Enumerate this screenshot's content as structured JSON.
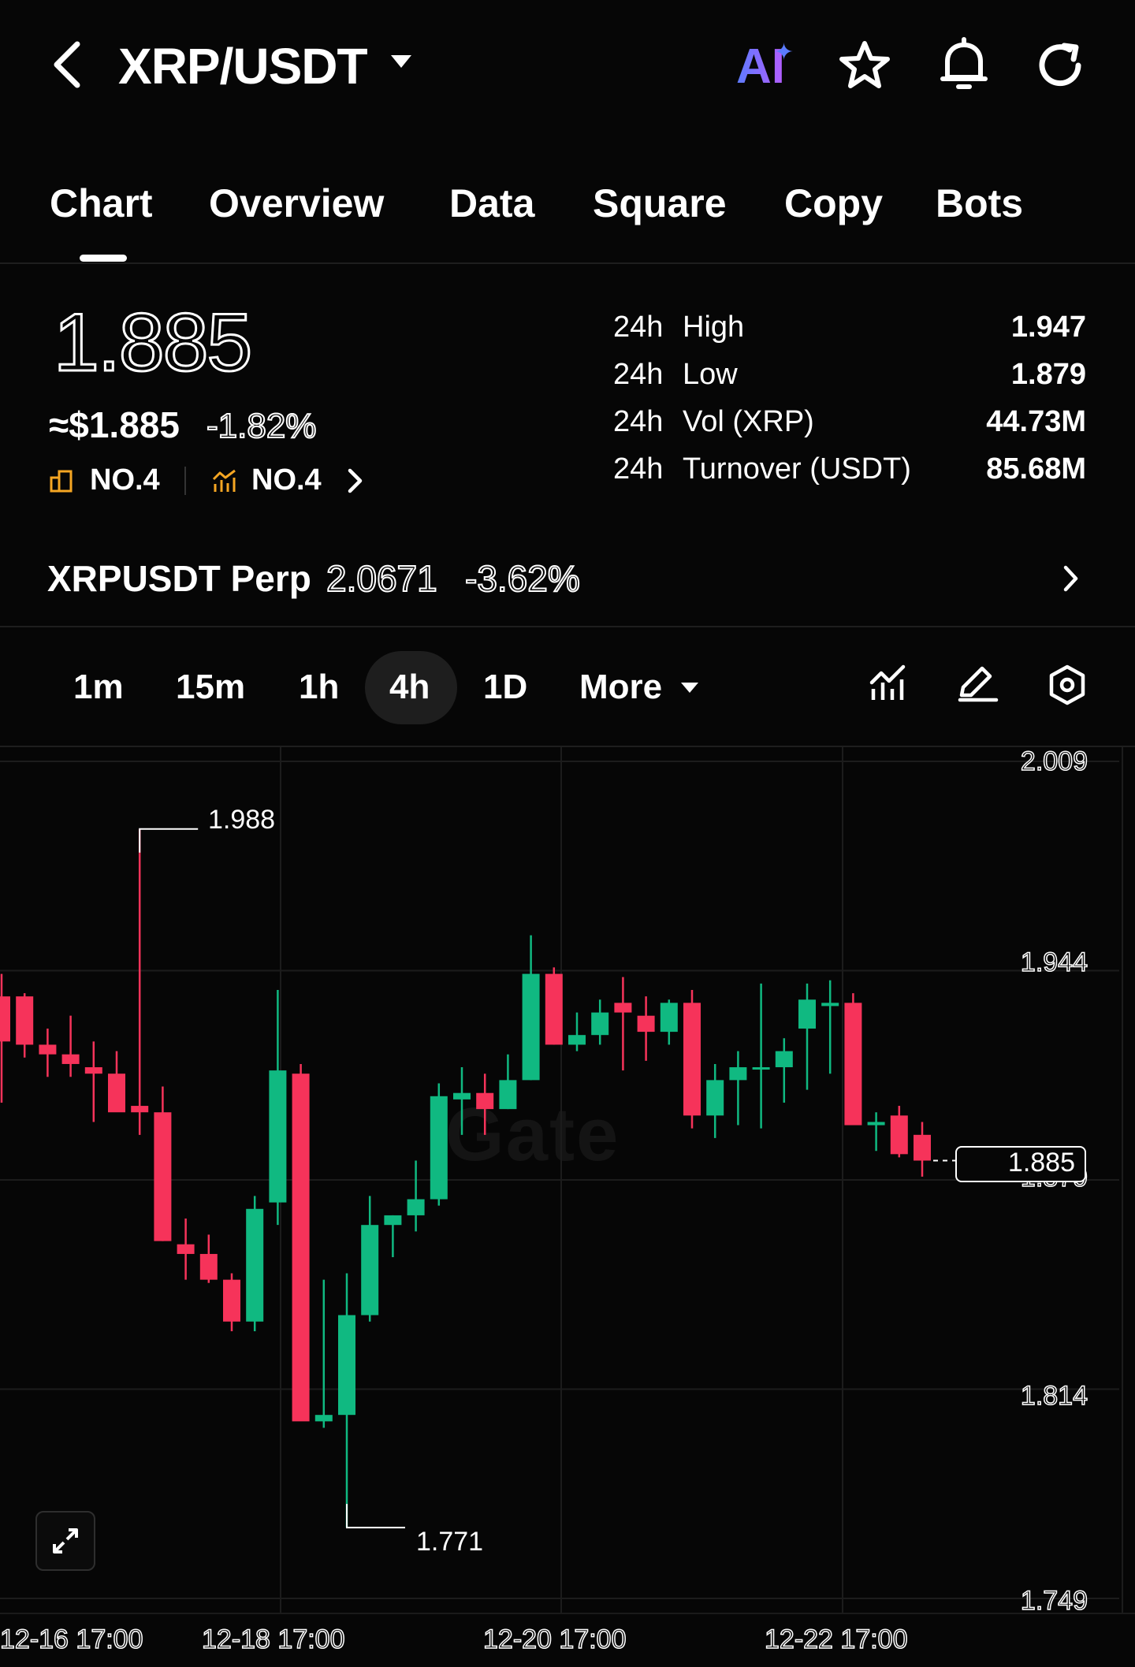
{
  "header": {
    "pair": "XRP/USDT",
    "ai_label": "AI"
  },
  "tabs": [
    {
      "label": "Chart",
      "active": true
    },
    {
      "label": "Overview"
    },
    {
      "label": "Data"
    },
    {
      "label": "Square"
    },
    {
      "label": "Copy"
    },
    {
      "label": "Bots"
    }
  ],
  "price": {
    "last": "1.885",
    "usd": "≈$1.885",
    "change": "-1.82%",
    "rank1": "NO.4",
    "rank2": "NO.4"
  },
  "stats": [
    {
      "period": "24h",
      "label": "High",
      "value": "1.947"
    },
    {
      "period": "24h",
      "label": "Low",
      "value": "1.879"
    },
    {
      "period": "24h",
      "label": "Vol (XRP)",
      "value": "44.73M"
    },
    {
      "period": "24h",
      "label": "Turnover (USDT)",
      "value": "85.68M"
    }
  ],
  "perp": {
    "name": "XRPUSDT Perp",
    "price": "2.0671",
    "change": "-3.62%"
  },
  "intervals": [
    "1m",
    "15m",
    "1h",
    "4h",
    "1D",
    "More"
  ],
  "active_interval": "4h",
  "colors": {
    "up": "#10b981",
    "down": "#f6335a",
    "background": "#060606"
  },
  "chart_data": {
    "type": "candlestick",
    "watermark": "Gate",
    "y_ticks": [
      "2.009",
      "1.944",
      "1.879",
      "1.814",
      "1.749"
    ],
    "ylim": [
      1.749,
      2.009
    ],
    "x_ticks": [
      "12-16 17:00",
      "12-18 17:00",
      "12-20 17:00",
      "12-22 17:00"
    ],
    "high_label": "1.988",
    "low_label": "1.771",
    "last_price_label": "1.885",
    "candles": [
      {
        "o": 1.936,
        "h": 1.943,
        "l": 1.903,
        "c": 1.922
      },
      {
        "o": 1.936,
        "h": 1.937,
        "l": 1.917,
        "c": 1.921
      },
      {
        "o": 1.921,
        "h": 1.926,
        "l": 1.911,
        "c": 1.918
      },
      {
        "o": 1.918,
        "h": 1.93,
        "l": 1.911,
        "c": 1.915
      },
      {
        "o": 1.914,
        "h": 1.922,
        "l": 1.897,
        "c": 1.912
      },
      {
        "o": 1.912,
        "h": 1.919,
        "l": 1.901,
        "c": 1.9
      },
      {
        "o": 1.902,
        "h": 1.988,
        "l": 1.893,
        "c": 1.9
      },
      {
        "o": 1.9,
        "h": 1.908,
        "l": 1.86,
        "c": 1.86
      },
      {
        "o": 1.859,
        "h": 1.867,
        "l": 1.848,
        "c": 1.856
      },
      {
        "o": 1.856,
        "h": 1.862,
        "l": 1.847,
        "c": 1.848
      },
      {
        "o": 1.848,
        "h": 1.85,
        "l": 1.832,
        "c": 1.835
      },
      {
        "o": 1.835,
        "h": 1.874,
        "l": 1.832,
        "c": 1.87
      },
      {
        "o": 1.872,
        "h": 1.938,
        "l": 1.865,
        "c": 1.913
      },
      {
        "o": 1.912,
        "h": 1.915,
        "l": 1.805,
        "c": 1.804
      },
      {
        "o": 1.804,
        "h": 1.848,
        "l": 1.802,
        "c": 1.806
      },
      {
        "o": 1.806,
        "h": 1.85,
        "l": 1.771,
        "c": 1.837
      },
      {
        "o": 1.837,
        "h": 1.874,
        "l": 1.835,
        "c": 1.865
      },
      {
        "o": 1.865,
        "h": 1.868,
        "l": 1.855,
        "c": 1.868
      },
      {
        "o": 1.868,
        "h": 1.885,
        "l": 1.863,
        "c": 1.873
      },
      {
        "o": 1.873,
        "h": 1.909,
        "l": 1.871,
        "c": 1.905
      },
      {
        "o": 1.904,
        "h": 1.914,
        "l": 1.893,
        "c": 1.906
      },
      {
        "o": 1.906,
        "h": 1.912,
        "l": 1.893,
        "c": 1.901
      },
      {
        "o": 1.901,
        "h": 1.918,
        "l": 1.901,
        "c": 1.91
      },
      {
        "o": 1.91,
        "h": 1.955,
        "l": 1.91,
        "c": 1.943
      },
      {
        "o": 1.943,
        "h": 1.945,
        "l": 1.921,
        "c": 1.921
      },
      {
        "o": 1.921,
        "h": 1.931,
        "l": 1.919,
        "c": 1.924
      },
      {
        "o": 1.924,
        "h": 1.935,
        "l": 1.921,
        "c": 1.931
      },
      {
        "o": 1.934,
        "h": 1.942,
        "l": 1.913,
        "c": 1.931
      },
      {
        "o": 1.93,
        "h": 1.936,
        "l": 1.916,
        "c": 1.925
      },
      {
        "o": 1.925,
        "h": 1.935,
        "l": 1.921,
        "c": 1.934
      },
      {
        "o": 1.934,
        "h": 1.938,
        "l": 1.895,
        "c": 1.899
      },
      {
        "o": 1.899,
        "h": 1.915,
        "l": 1.892,
        "c": 1.91
      },
      {
        "o": 1.91,
        "h": 1.919,
        "l": 1.896,
        "c": 1.914
      },
      {
        "o": 1.914,
        "h": 1.94,
        "l": 1.895,
        "c": 1.914
      },
      {
        "o": 1.914,
        "h": 1.923,
        "l": 1.903,
        "c": 1.919
      },
      {
        "o": 1.926,
        "h": 1.94,
        "l": 1.907,
        "c": 1.935
      },
      {
        "o": 1.933,
        "h": 1.941,
        "l": 1.912,
        "c": 1.934
      },
      {
        "o": 1.934,
        "h": 1.937,
        "l": 1.896,
        "c": 1.896
      },
      {
        "o": 1.896,
        "h": 1.9,
        "l": 1.888,
        "c": 1.897
      },
      {
        "o": 1.899,
        "h": 1.902,
        "l": 1.886,
        "c": 1.887
      },
      {
        "o": 1.893,
        "h": 1.897,
        "l": 1.88,
        "c": 1.885
      }
    ]
  }
}
